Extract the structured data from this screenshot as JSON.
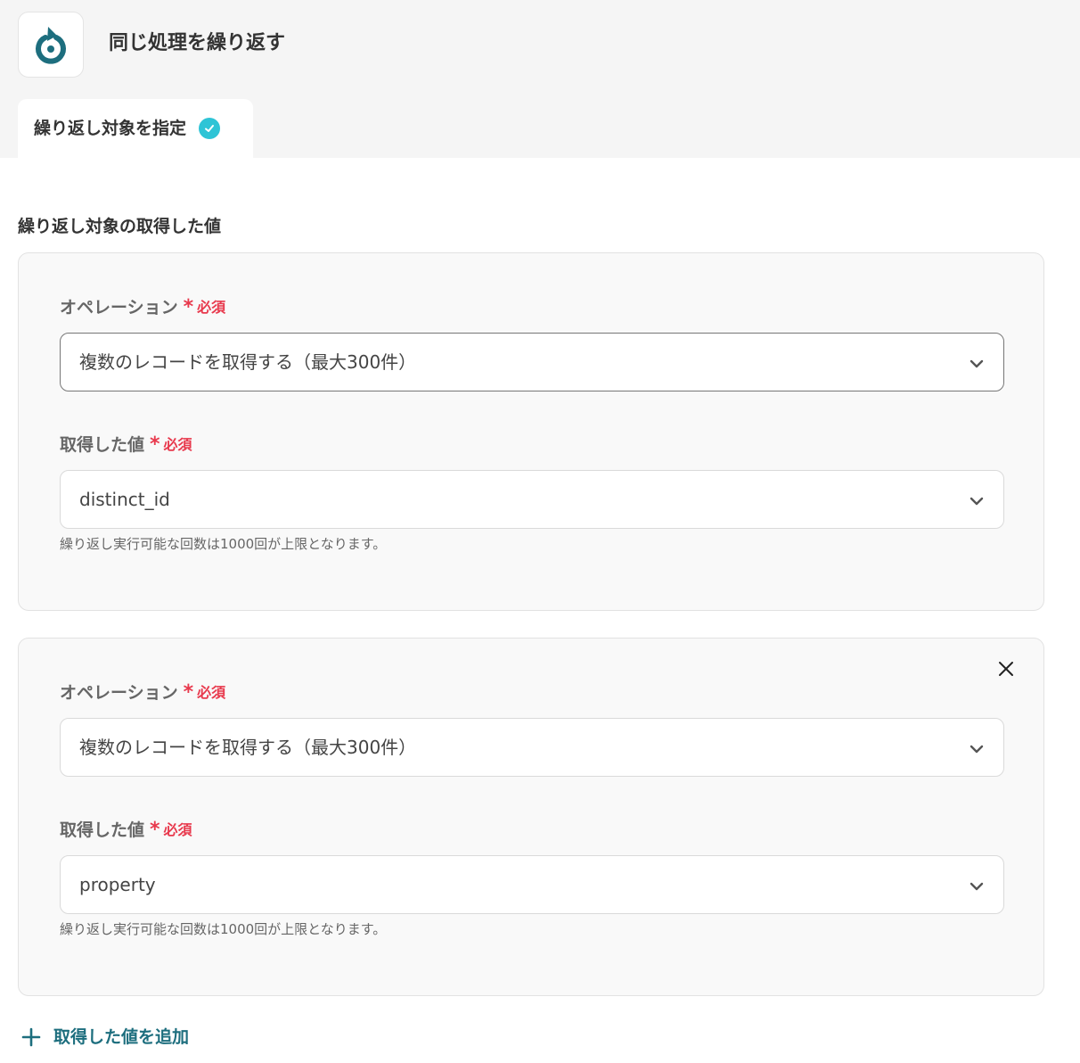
{
  "header": {
    "app_icon": "refresh-icon",
    "title": "同じ処理を繰り返す",
    "tab_label": "繰り返し対象を指定",
    "tab_status_icon": "check-icon"
  },
  "section": {
    "title": "繰り返し対象の取得した値"
  },
  "cards": [
    {
      "operation_label": "オペレーション",
      "operation_required": "必須",
      "operation_value": "複数のレコードを取得する（最大300件）",
      "value_label": "取得した値",
      "value_required": "必須",
      "value_value": "distinct_id",
      "hint": "繰り返し実行可能な回数は1000回が上限となります。"
    },
    {
      "operation_label": "オペレーション",
      "operation_required": "必須",
      "operation_value": "複数のレコードを取得する（最大300件）",
      "value_label": "取得した値",
      "value_required": "必須",
      "value_value": "property",
      "hint": "繰り返し実行可能な回数は1000回が上限となります。"
    }
  ],
  "add_button": {
    "label": "取得した値を追加"
  },
  "colors": {
    "accent": "#1d6e7e",
    "check": "#2ec4d6",
    "required": "#e8394d",
    "background": "#f5f5f5"
  }
}
